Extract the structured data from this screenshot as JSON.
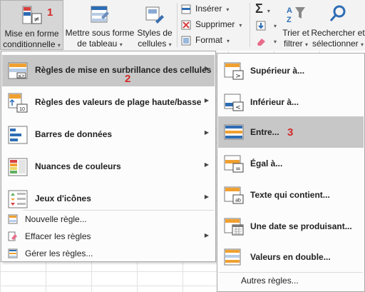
{
  "ribbon": {
    "mise_en_forme": {
      "line1": "Mise en forme",
      "line2": "conditionnelle"
    },
    "mettre_sous_forme": {
      "line1": "Mettre sous forme",
      "line2": "de tableau"
    },
    "styles": {
      "line1": "Styles de",
      "line2": "cellules"
    },
    "inserer": "Insérer",
    "supprimer": "Supprimer",
    "format": "Format",
    "trier": {
      "line1": "Trier et",
      "line2": "filtrer"
    },
    "rechercher": {
      "line1": "Rechercher et",
      "line2": "sélectionner"
    },
    "dropdown_glyph": "▾"
  },
  "markers": {
    "m1": "1",
    "m2": "2",
    "m3": "3"
  },
  "main_menu": {
    "items": [
      {
        "label": "Règles de mise en surbrillance des cellules",
        "icon": "highlight-rules-icon"
      },
      {
        "label": "Règles des valeurs de plage haute/basse",
        "icon": "top-bottom-rules-icon"
      },
      {
        "label": "Barres de données",
        "icon": "data-bars-icon"
      },
      {
        "label": "Nuances de couleurs",
        "icon": "color-scales-icon"
      },
      {
        "label": "Jeux d'icônes",
        "icon": "icon-sets-icon"
      }
    ],
    "small_items": [
      {
        "label": "Nouvelle règle...",
        "icon": "new-rule-icon"
      },
      {
        "label": "Effacer les règles",
        "icon": "clear-rules-icon"
      },
      {
        "label": "Gérer les règles...",
        "icon": "manage-rules-icon"
      }
    ],
    "top_bottom_badge": "10"
  },
  "sub_menu": {
    "items": [
      {
        "label": "Supérieur à...",
        "icon": "greater-than-icon"
      },
      {
        "label": "Inférieur à...",
        "icon": "less-than-icon"
      },
      {
        "label": "Entre...",
        "icon": "between-icon"
      },
      {
        "label": "Égal à...",
        "icon": "equal-to-icon"
      },
      {
        "label": "Texte qui contient...",
        "icon": "text-contains-icon"
      },
      {
        "label": "Une date se produisant...",
        "icon": "date-occurring-icon"
      },
      {
        "label": "Valeurs en double...",
        "icon": "duplicate-values-icon"
      }
    ],
    "more": "Autres règles...",
    "icon_symbols": {
      "greater": ">",
      "less": "<",
      "equal": "=",
      "text": "ab"
    }
  },
  "colors": {
    "highlight": "#c7c7c7",
    "marker": "#d42a2a",
    "accent_blue": "#2e6db4",
    "accent_orange": "#f0a030"
  }
}
